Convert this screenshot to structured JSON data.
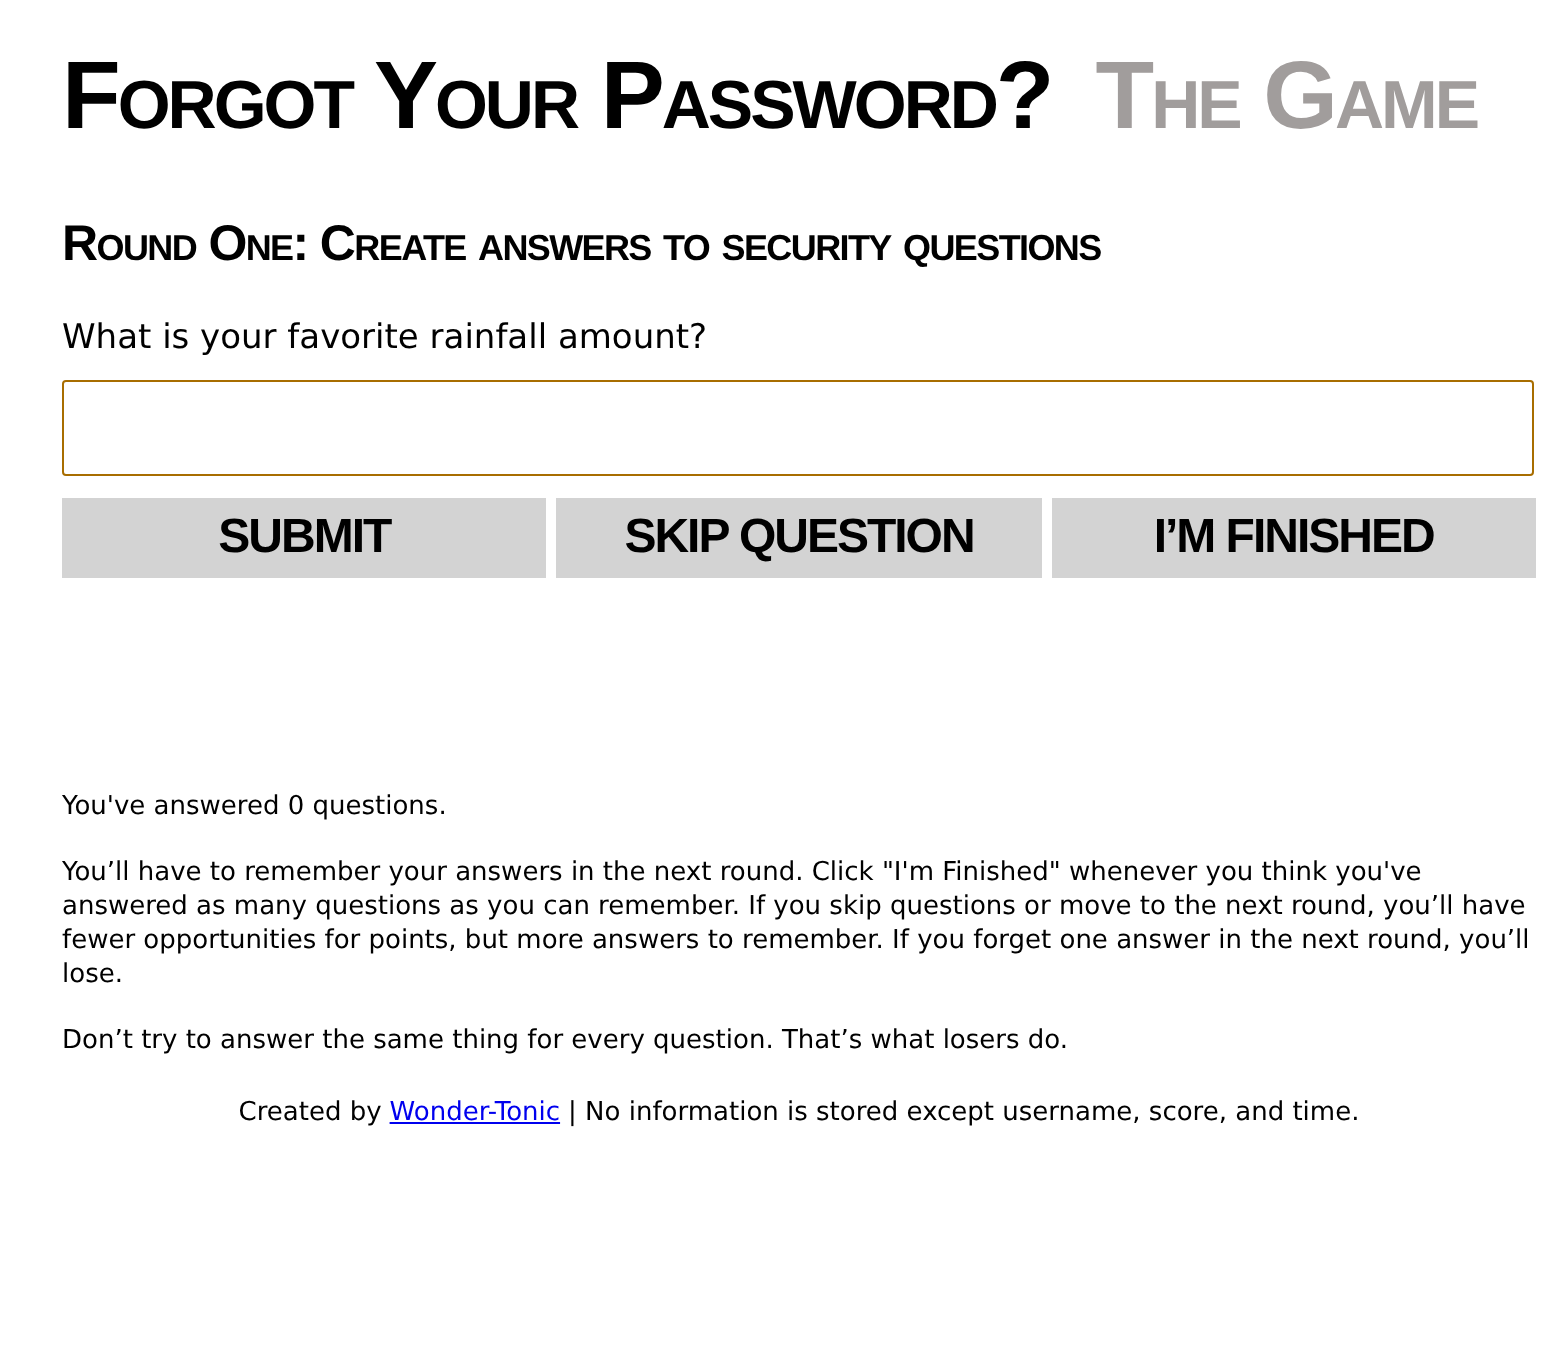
{
  "title": {
    "main": "Forgot Your Password?",
    "suffix": "The Game"
  },
  "round_heading": "Round One: Create answers to security questions",
  "question": "What is your favorite rainfall amount?",
  "answer_field": {
    "focused": true
  },
  "buttons": [
    "SUBMIT",
    "SKIP QUESTION",
    "I’M FINISHED"
  ],
  "status": "You've answered 0 questions.",
  "instructions": "You’ll have to remember your answers in the next round. Click \"I'm Finished\" whenever you think you've answered as many questions as you can remember. If you skip questions or move to the next round, you’ll have fewer opportunities for points, but more answers to remember. If you forget one answer in the next round, you’ll lose.",
  "warning": "Don’t try to answer the same thing for every question. That’s what losers do.",
  "footer": {
    "prefix": "Created by",
    "link": "Wonder-Tonic",
    "suffix": "| No information is stored except username, score, and time."
  }
}
